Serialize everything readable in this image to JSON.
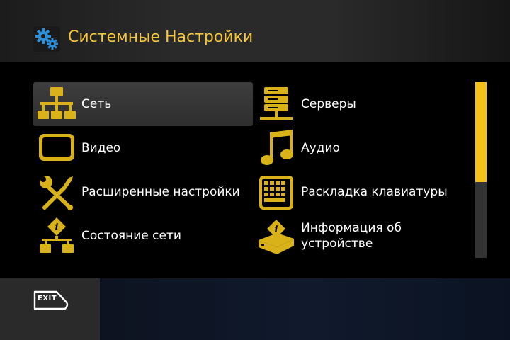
{
  "header": {
    "title": "Системные Настройки",
    "icon": "gear-icon"
  },
  "menu": {
    "items": [
      {
        "label": "Сеть",
        "icon": "network-icon",
        "selected": true
      },
      {
        "label": "Серверы",
        "icon": "servers-icon",
        "selected": false
      },
      {
        "label": "Видео",
        "icon": "tv-icon",
        "selected": false
      },
      {
        "label": "Аудио",
        "icon": "music-note-icon",
        "selected": false
      },
      {
        "label": "Расширенные настройки",
        "icon": "tools-icon",
        "selected": false
      },
      {
        "label": "Раскладка клавиатуры",
        "icon": "keyboard-icon",
        "selected": false
      },
      {
        "label": "Состояние сети",
        "icon": "network-status-icon",
        "selected": false
      },
      {
        "label": "Информация об\nустройстве",
        "label_lines": [
          "Информация об",
          "устройстве"
        ],
        "icon": "device-info-icon",
        "selected": false
      }
    ]
  },
  "footer": {
    "exit_label": "EXIT",
    "exit_icon": "exit-key-icon"
  },
  "scrollbar": {
    "thumb_fraction": 0.57
  },
  "colors": {
    "accent": "#f6c01a",
    "icon_gold": "#d9b21a",
    "title": "#f4c43a",
    "gear_blue": "#2e8fd6"
  }
}
